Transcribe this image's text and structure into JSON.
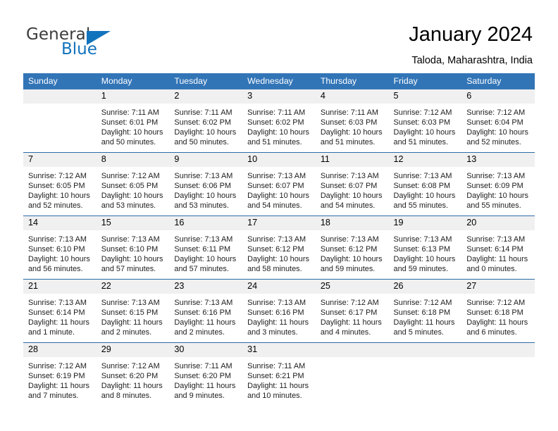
{
  "brand": {
    "name_part1": "General",
    "name_part2": "Blue"
  },
  "header": {
    "title": "January 2024",
    "subtitle": "Taloda, Maharashtra, India"
  },
  "colors": {
    "header_blue": "#3275b7",
    "rule_blue": "#2d6ca8",
    "daynum_band": "#f0f0f0",
    "brand_blue": "#1273bd"
  },
  "weekday_headers": [
    "Sunday",
    "Monday",
    "Tuesday",
    "Wednesday",
    "Thursday",
    "Friday",
    "Saturday"
  ],
  "labels": {
    "sunrise_prefix": "Sunrise:",
    "sunset_prefix": "Sunset:",
    "daylight_prefix": "Daylight:"
  },
  "weeks": [
    [
      {
        "day": "",
        "sunrise": "",
        "sunset": "",
        "daylight_line1": "",
        "daylight_line2": ""
      },
      {
        "day": "1",
        "sunrise": "Sunrise: 7:11 AM",
        "sunset": "Sunset: 6:01 PM",
        "daylight_line1": "Daylight: 10 hours",
        "daylight_line2": "and 50 minutes."
      },
      {
        "day": "2",
        "sunrise": "Sunrise: 7:11 AM",
        "sunset": "Sunset: 6:02 PM",
        "daylight_line1": "Daylight: 10 hours",
        "daylight_line2": "and 50 minutes."
      },
      {
        "day": "3",
        "sunrise": "Sunrise: 7:11 AM",
        "sunset": "Sunset: 6:02 PM",
        "daylight_line1": "Daylight: 10 hours",
        "daylight_line2": "and 51 minutes."
      },
      {
        "day": "4",
        "sunrise": "Sunrise: 7:11 AM",
        "sunset": "Sunset: 6:03 PM",
        "daylight_line1": "Daylight: 10 hours",
        "daylight_line2": "and 51 minutes."
      },
      {
        "day": "5",
        "sunrise": "Sunrise: 7:12 AM",
        "sunset": "Sunset: 6:03 PM",
        "daylight_line1": "Daylight: 10 hours",
        "daylight_line2": "and 51 minutes."
      },
      {
        "day": "6",
        "sunrise": "Sunrise: 7:12 AM",
        "sunset": "Sunset: 6:04 PM",
        "daylight_line1": "Daylight: 10 hours",
        "daylight_line2": "and 52 minutes."
      }
    ],
    [
      {
        "day": "7",
        "sunrise": "Sunrise: 7:12 AM",
        "sunset": "Sunset: 6:05 PM",
        "daylight_line1": "Daylight: 10 hours",
        "daylight_line2": "and 52 minutes."
      },
      {
        "day": "8",
        "sunrise": "Sunrise: 7:12 AM",
        "sunset": "Sunset: 6:05 PM",
        "daylight_line1": "Daylight: 10 hours",
        "daylight_line2": "and 53 minutes."
      },
      {
        "day": "9",
        "sunrise": "Sunrise: 7:13 AM",
        "sunset": "Sunset: 6:06 PM",
        "daylight_line1": "Daylight: 10 hours",
        "daylight_line2": "and 53 minutes."
      },
      {
        "day": "10",
        "sunrise": "Sunrise: 7:13 AM",
        "sunset": "Sunset: 6:07 PM",
        "daylight_line1": "Daylight: 10 hours",
        "daylight_line2": "and 54 minutes."
      },
      {
        "day": "11",
        "sunrise": "Sunrise: 7:13 AM",
        "sunset": "Sunset: 6:07 PM",
        "daylight_line1": "Daylight: 10 hours",
        "daylight_line2": "and 54 minutes."
      },
      {
        "day": "12",
        "sunrise": "Sunrise: 7:13 AM",
        "sunset": "Sunset: 6:08 PM",
        "daylight_line1": "Daylight: 10 hours",
        "daylight_line2": "and 55 minutes."
      },
      {
        "day": "13",
        "sunrise": "Sunrise: 7:13 AM",
        "sunset": "Sunset: 6:09 PM",
        "daylight_line1": "Daylight: 10 hours",
        "daylight_line2": "and 55 minutes."
      }
    ],
    [
      {
        "day": "14",
        "sunrise": "Sunrise: 7:13 AM",
        "sunset": "Sunset: 6:10 PM",
        "daylight_line1": "Daylight: 10 hours",
        "daylight_line2": "and 56 minutes."
      },
      {
        "day": "15",
        "sunrise": "Sunrise: 7:13 AM",
        "sunset": "Sunset: 6:10 PM",
        "daylight_line1": "Daylight: 10 hours",
        "daylight_line2": "and 57 minutes."
      },
      {
        "day": "16",
        "sunrise": "Sunrise: 7:13 AM",
        "sunset": "Sunset: 6:11 PM",
        "daylight_line1": "Daylight: 10 hours",
        "daylight_line2": "and 57 minutes."
      },
      {
        "day": "17",
        "sunrise": "Sunrise: 7:13 AM",
        "sunset": "Sunset: 6:12 PM",
        "daylight_line1": "Daylight: 10 hours",
        "daylight_line2": "and 58 minutes."
      },
      {
        "day": "18",
        "sunrise": "Sunrise: 7:13 AM",
        "sunset": "Sunset: 6:12 PM",
        "daylight_line1": "Daylight: 10 hours",
        "daylight_line2": "and 59 minutes."
      },
      {
        "day": "19",
        "sunrise": "Sunrise: 7:13 AM",
        "sunset": "Sunset: 6:13 PM",
        "daylight_line1": "Daylight: 10 hours",
        "daylight_line2": "and 59 minutes."
      },
      {
        "day": "20",
        "sunrise": "Sunrise: 7:13 AM",
        "sunset": "Sunset: 6:14 PM",
        "daylight_line1": "Daylight: 11 hours",
        "daylight_line2": "and 0 minutes."
      }
    ],
    [
      {
        "day": "21",
        "sunrise": "Sunrise: 7:13 AM",
        "sunset": "Sunset: 6:14 PM",
        "daylight_line1": "Daylight: 11 hours",
        "daylight_line2": "and 1 minute."
      },
      {
        "day": "22",
        "sunrise": "Sunrise: 7:13 AM",
        "sunset": "Sunset: 6:15 PM",
        "daylight_line1": "Daylight: 11 hours",
        "daylight_line2": "and 2 minutes."
      },
      {
        "day": "23",
        "sunrise": "Sunrise: 7:13 AM",
        "sunset": "Sunset: 6:16 PM",
        "daylight_line1": "Daylight: 11 hours",
        "daylight_line2": "and 2 minutes."
      },
      {
        "day": "24",
        "sunrise": "Sunrise: 7:13 AM",
        "sunset": "Sunset: 6:16 PM",
        "daylight_line1": "Daylight: 11 hours",
        "daylight_line2": "and 3 minutes."
      },
      {
        "day": "25",
        "sunrise": "Sunrise: 7:12 AM",
        "sunset": "Sunset: 6:17 PM",
        "daylight_line1": "Daylight: 11 hours",
        "daylight_line2": "and 4 minutes."
      },
      {
        "day": "26",
        "sunrise": "Sunrise: 7:12 AM",
        "sunset": "Sunset: 6:18 PM",
        "daylight_line1": "Daylight: 11 hours",
        "daylight_line2": "and 5 minutes."
      },
      {
        "day": "27",
        "sunrise": "Sunrise: 7:12 AM",
        "sunset": "Sunset: 6:18 PM",
        "daylight_line1": "Daylight: 11 hours",
        "daylight_line2": "and 6 minutes."
      }
    ],
    [
      {
        "day": "28",
        "sunrise": "Sunrise: 7:12 AM",
        "sunset": "Sunset: 6:19 PM",
        "daylight_line1": "Daylight: 11 hours",
        "daylight_line2": "and 7 minutes."
      },
      {
        "day": "29",
        "sunrise": "Sunrise: 7:12 AM",
        "sunset": "Sunset: 6:20 PM",
        "daylight_line1": "Daylight: 11 hours",
        "daylight_line2": "and 8 minutes."
      },
      {
        "day": "30",
        "sunrise": "Sunrise: 7:11 AM",
        "sunset": "Sunset: 6:20 PM",
        "daylight_line1": "Daylight: 11 hours",
        "daylight_line2": "and 9 minutes."
      },
      {
        "day": "31",
        "sunrise": "Sunrise: 7:11 AM",
        "sunset": "Sunset: 6:21 PM",
        "daylight_line1": "Daylight: 11 hours",
        "daylight_line2": "and 10 minutes."
      },
      {
        "day": "",
        "sunrise": "",
        "sunset": "",
        "daylight_line1": "",
        "daylight_line2": ""
      },
      {
        "day": "",
        "sunrise": "",
        "sunset": "",
        "daylight_line1": "",
        "daylight_line2": ""
      },
      {
        "day": "",
        "sunrise": "",
        "sunset": "",
        "daylight_line1": "",
        "daylight_line2": ""
      }
    ]
  ]
}
